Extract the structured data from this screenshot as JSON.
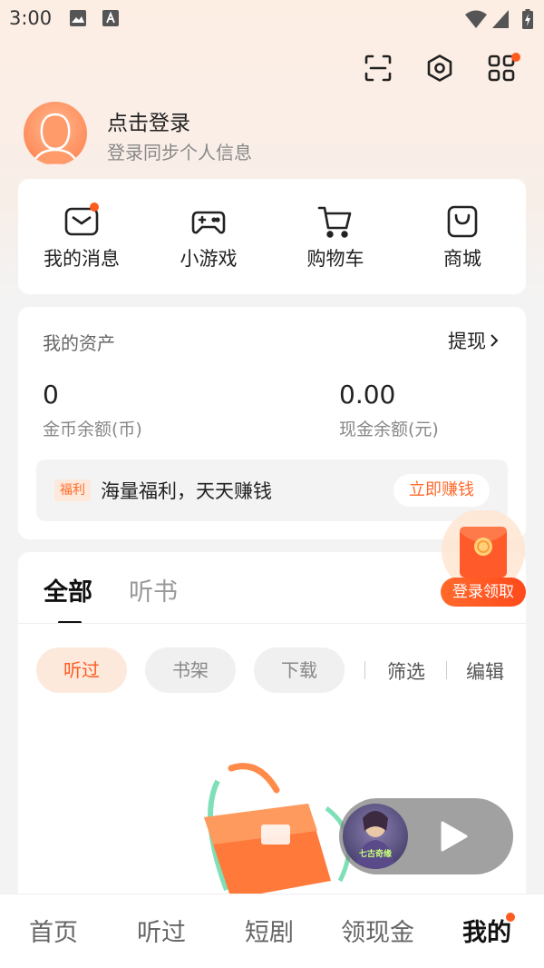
{
  "status_bar": {
    "time": "3:00"
  },
  "profile": {
    "title": "点击登录",
    "subtitle": "登录同步个人信息"
  },
  "quick_actions": [
    {
      "label": "我的消息",
      "icon": "message-icon",
      "badge": true
    },
    {
      "label": "小游戏",
      "icon": "gamepad-icon",
      "badge": false
    },
    {
      "label": "购物车",
      "icon": "cart-icon",
      "badge": false
    },
    {
      "label": "商城",
      "icon": "shopping-bag-icon",
      "badge": false
    }
  ],
  "assets": {
    "title": "我的资产",
    "withdraw_label": "提现",
    "coins_value": "0",
    "coins_label": "金币余额(币)",
    "cash_value": "0.00",
    "cash_label": "现金余额(元)",
    "bonus_tag": "福利",
    "bonus_text": "海量福利，天天赚钱",
    "earn_button": "立即赚钱"
  },
  "redpack": {
    "label": "登录领取"
  },
  "list": {
    "tabs": [
      "全部",
      "听书"
    ],
    "chips": [
      "听过",
      "书架",
      "下载"
    ],
    "filter_label": "筛选",
    "edit_label": "编辑"
  },
  "player": {
    "cover_text": "七古奇缘"
  },
  "bottom_nav": [
    "首页",
    "听过",
    "短剧",
    "领现金",
    "我的"
  ],
  "colors": {
    "accent": "#ff5a1f",
    "background": "#f3f3f3"
  }
}
